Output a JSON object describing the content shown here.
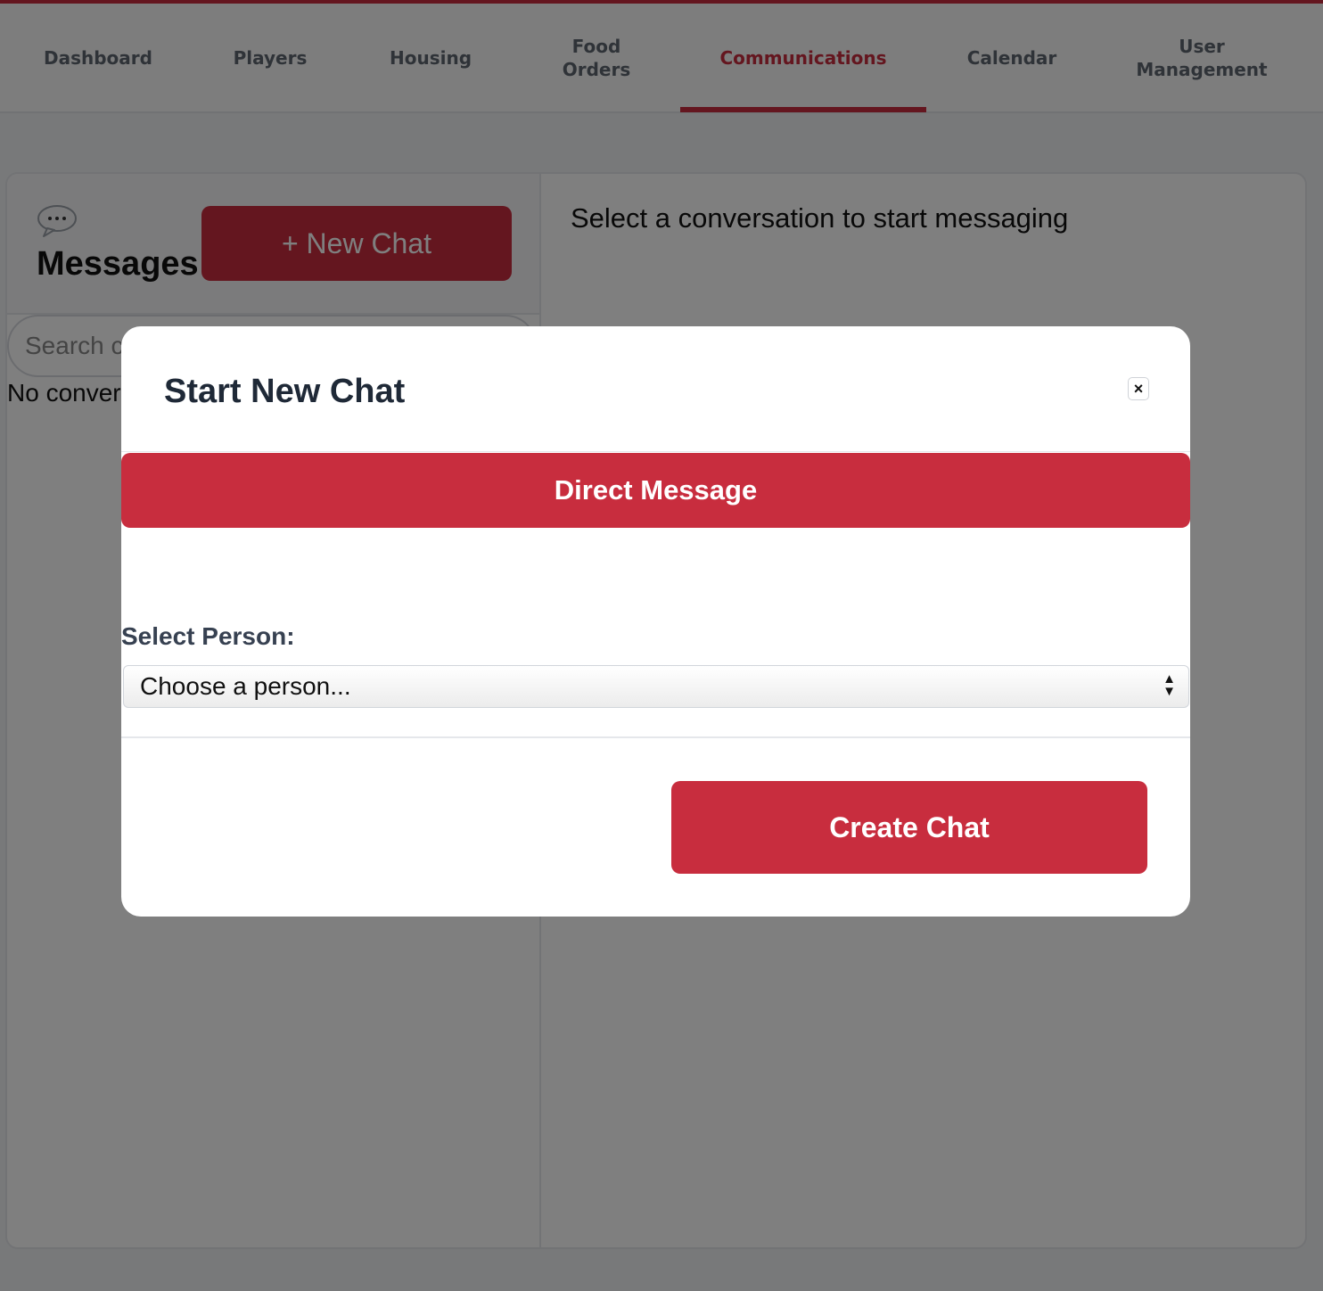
{
  "nav": {
    "items": [
      {
        "label": "Dashboard"
      },
      {
        "label": "Players"
      },
      {
        "label": "Housing"
      },
      {
        "label": "Food Orders"
      },
      {
        "label": "Communications"
      },
      {
        "label": "Calendar"
      },
      {
        "label": "User Management"
      }
    ],
    "active": "Communications"
  },
  "messages": {
    "title": "Messages",
    "new_chat_label": "+ New Chat",
    "search_placeholder": "Search conversations...",
    "empty_text": "No conversations",
    "select_prompt": "Select a conversation to start messaging",
    "icon": "speech-bubble-icon"
  },
  "modal": {
    "title": "Start New Chat",
    "close_label": "×",
    "tab_label": "Direct Message",
    "select_label": "Select Person:",
    "select_value": "Choose a person...",
    "create_label": "Create Chat"
  },
  "colors": {
    "accent": "#c82d3e",
    "overlay": "rgba(0,0,0,0.5)"
  }
}
